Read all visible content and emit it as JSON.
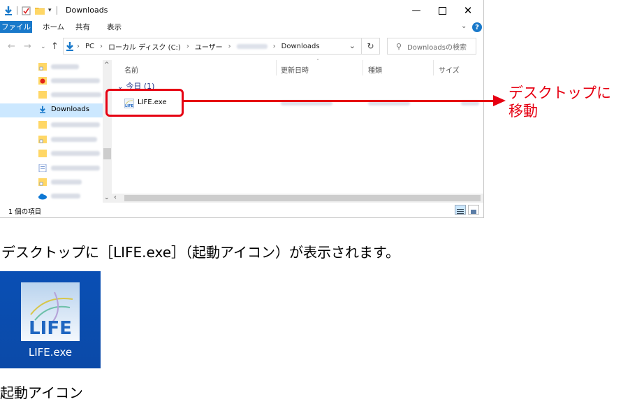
{
  "window": {
    "title": "Downloads",
    "tabs": {
      "file": "ファイル",
      "home": "ホーム",
      "share": "共有",
      "view": "表示"
    },
    "path": [
      "PC",
      "ローカル ディスク (C:)",
      "ユーザー",
      "Downloads"
    ],
    "search_placeholder": "Downloadsの検索",
    "columns": {
      "name": "名前",
      "date": "更新日時",
      "type": "種類",
      "size": "サイズ"
    },
    "group_label": "今日 (1)",
    "file_name": "LIFE.exe",
    "nav_selected": "Downloads",
    "status": "1 個の項目"
  },
  "annotation": {
    "line1": "デスクトップに",
    "line2": "移動"
  },
  "caption": "デスクトップに［LIFE.exe］（起動アイコン）が表示されます。",
  "desktop_icon": {
    "label": "LIFE.exe",
    "logo_text": "LIFE"
  },
  "caption2": "起動アイコン",
  "colors": {
    "accent": "#1979ca",
    "highlight": "#e60012",
    "desktop": "#0b4aa8"
  }
}
